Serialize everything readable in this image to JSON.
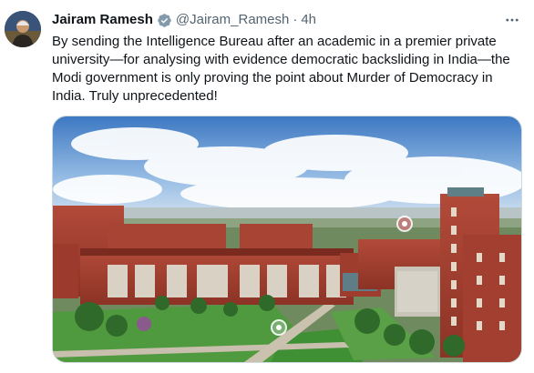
{
  "tweet": {
    "author_name": "Jairam Ramesh",
    "handle": "@Jairam_Ramesh",
    "separator": "·",
    "time": "4h",
    "verified": true,
    "text": "By sending the Intelligence Bureau after an academic in a premier private university—for analysing with evidence democratic backsliding in India—the Modi government is only proving the point about Murder of Democracy in India. Truly unprecedented!",
    "media": {
      "type": "photo",
      "description_icon": "campus-photo"
    }
  },
  "icons": {
    "verified": "verified-badge-icon",
    "more": "more-options-icon"
  },
  "colors": {
    "primary_text": "#0f1419",
    "secondary_text": "#536471",
    "verified_badge": "#829aab",
    "border": "#cfd9de"
  }
}
